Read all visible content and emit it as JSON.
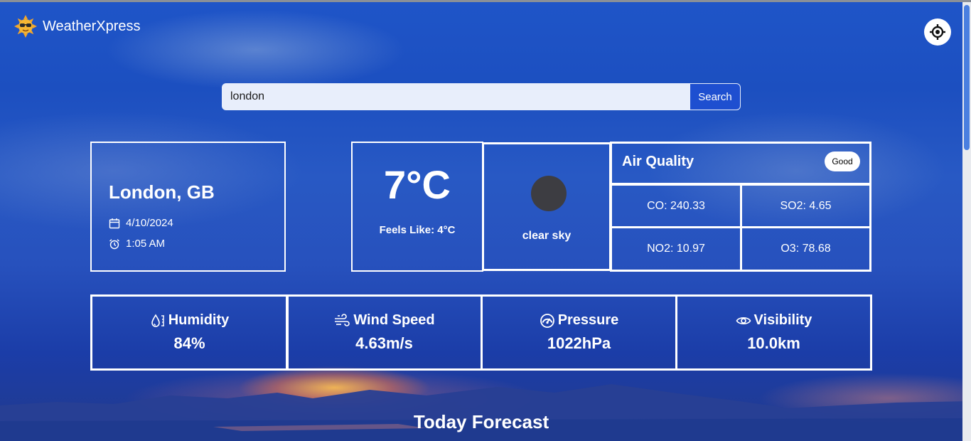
{
  "colors": {
    "accent": "#1e4fd0",
    "card_border": "#ffffff",
    "badge_bg": "#ffffff",
    "weather_icon": "#3d3d42"
  },
  "header": {
    "app_name": "WeatherXpress",
    "logo_icon": "sun-with-sunglasses-icon",
    "locate_icon": "crosshair-location-icon"
  },
  "search": {
    "value": "london",
    "button_label": "Search"
  },
  "city": {
    "name": "London, GB",
    "date": "4/10/2024",
    "date_icon": "calendar-icon",
    "time": "1:05 AM",
    "time_icon": "alarm-clock-icon"
  },
  "current": {
    "temperature": "7°C",
    "feels_like": "Feels Like: 4°C",
    "condition": "clear sky",
    "condition_icon": "weather-condition-icon"
  },
  "air_quality": {
    "title": "Air Quality",
    "status": "Good",
    "co": "CO: 240.33",
    "so2": "SO2: 4.65",
    "no2": "NO2: 10.97",
    "o3": "O3: 78.68"
  },
  "stats": [
    {
      "label": "Humidity",
      "value": "84%",
      "icon": "humidity-icon"
    },
    {
      "label": "Wind Speed",
      "value": "4.63m/s",
      "icon": "wind-icon"
    },
    {
      "label": "Pressure",
      "value": "1022hPa",
      "icon": "gauge-icon"
    },
    {
      "label": "Visibility",
      "value": "10.0km",
      "icon": "eye-icon"
    }
  ],
  "forecast": {
    "title": "Today Forecast"
  }
}
